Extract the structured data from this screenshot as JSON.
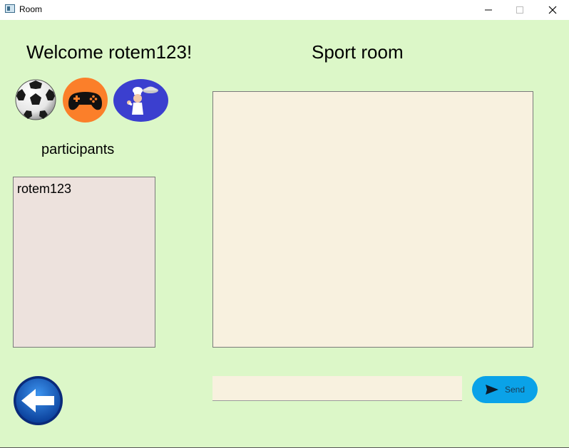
{
  "window": {
    "title": "Room",
    "icons": [
      "app-icon",
      "minimize-icon",
      "maximize-icon",
      "close-icon"
    ]
  },
  "header": {
    "welcome": "Welcome rotem123!",
    "room_name": "Sport room"
  },
  "categories": [
    {
      "name": "sport",
      "icon": "soccer-ball-icon"
    },
    {
      "name": "gaming",
      "icon": "gamepad-icon"
    },
    {
      "name": "cooking",
      "icon": "chef-icon"
    }
  ],
  "participants": {
    "label": "participants",
    "items": [
      "rotem123"
    ]
  },
  "chat": {
    "messages": []
  },
  "composer": {
    "input_value": "",
    "send_label": "Send",
    "send_icon": "send-arrow-icon"
  },
  "navigation": {
    "back_icon": "back-arrow-icon"
  },
  "colors": {
    "background": "#dcf7c8",
    "chat_background": "#f8f1df",
    "participants_background": "#ede2dd",
    "send_button": "#0aa2e8",
    "gamepad_circle": "#fb7f2a",
    "chef_circle": "#3b3fcf",
    "back_button": "#1260c8"
  }
}
